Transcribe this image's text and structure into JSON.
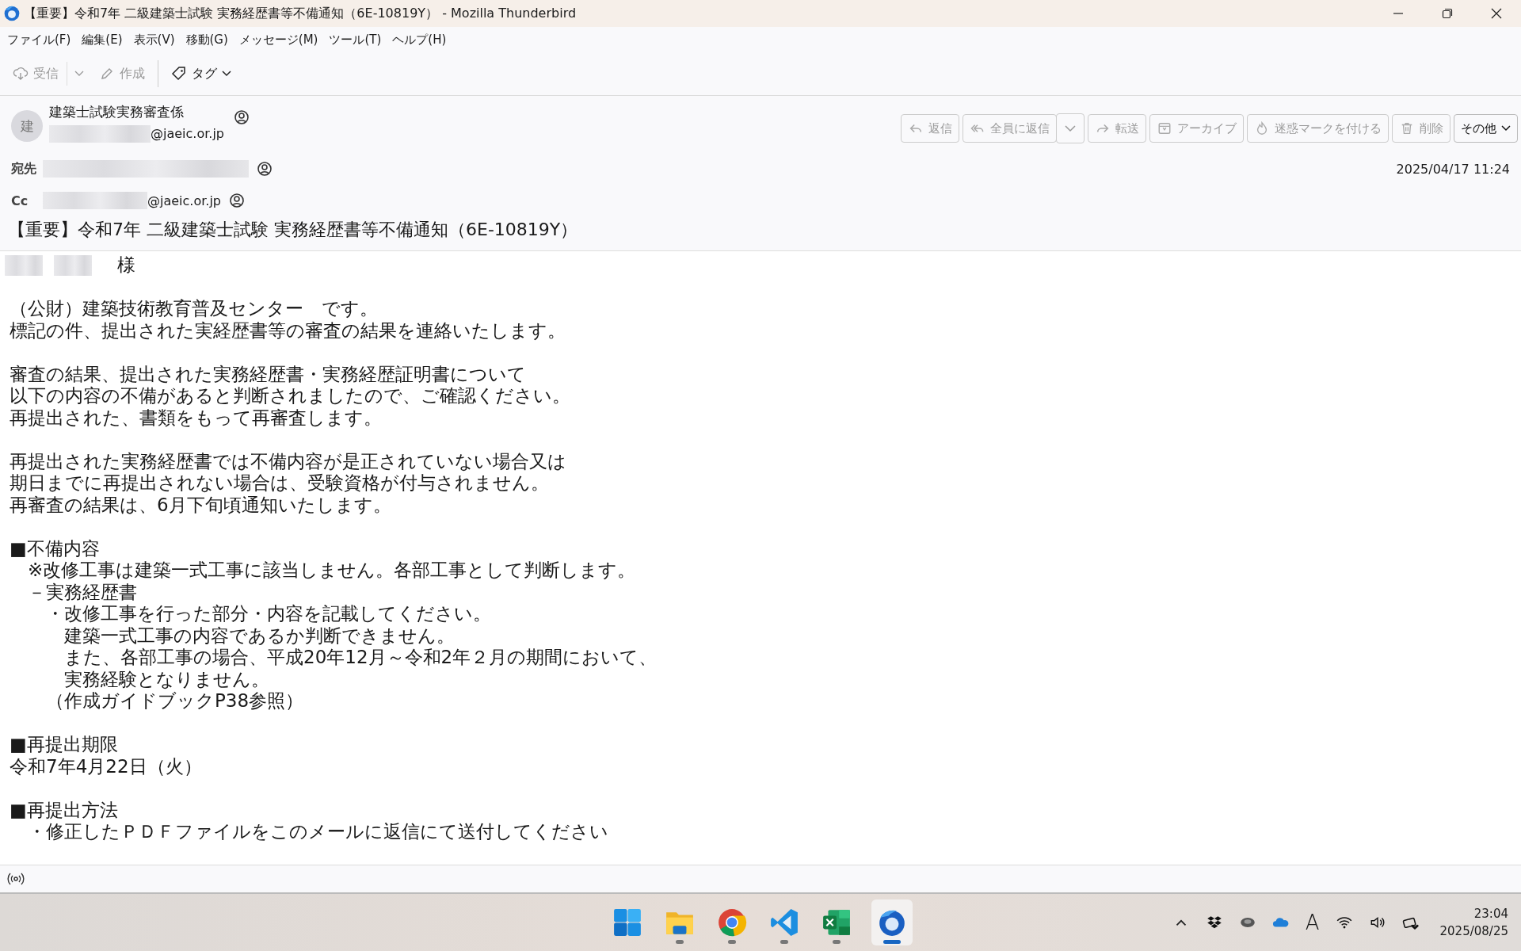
{
  "window": {
    "title": "【重要】令和7年 二級建築士試験 実務経歴書等不備通知（6E-10819Y） - Mozilla Thunderbird"
  },
  "menu": [
    "ファイル(F)",
    "編集(E)",
    "表示(V)",
    "移動(G)",
    "メッセージ(M)",
    "ツール(T)",
    "ヘルプ(H)"
  ],
  "toolbar": [
    {
      "kind": "get",
      "label": "受信",
      "disabled": true
    },
    {
      "kind": "write",
      "label": "作成",
      "disabled": true
    },
    {
      "kind": "tag",
      "label": "タグ",
      "disabled": false
    }
  ],
  "message": {
    "avatar": "建",
    "sender": "建築士試験実務審査係",
    "sender_domain": "@jaeic.or.jp",
    "to_label": "宛先",
    "cc_label": "Cc",
    "cc_domain": "@jaeic.or.jp",
    "date": "2025/04/17 11:24",
    "subject": "【重要】令和7年 二級建築士試験 実務経歴書等不備通知（6E-10819Y）",
    "actions": [
      {
        "kind": "reply",
        "label": "返信",
        "disabled": true
      },
      {
        "kind": "reply-all",
        "label": "全員に返信",
        "disabled": true
      },
      {
        "kind": "forward",
        "label": "転送",
        "disabled": true
      },
      {
        "kind": "archive",
        "label": "アーカイブ",
        "disabled": true
      },
      {
        "kind": "junk",
        "label": "迷惑マークを付ける",
        "disabled": true
      },
      {
        "kind": "delete",
        "label": "削除",
        "disabled": true
      },
      {
        "kind": "more",
        "label": "その他",
        "disabled": false
      }
    ]
  },
  "body": {
    "salutation": "様",
    "paragraphs": [
      [
        "（公財）建築技術教育普及センター　です。",
        "標記の件、提出された実経歴書等の審査の結果を連絡いたします。"
      ],
      [
        "審査の結果、提出された実務経歴書・実務経歴証明書について",
        "以下の内容の不備があると判断されましたので、ご確認ください。",
        "再提出された、書類をもって再審査します。"
      ],
      [
        "再提出された実務経歴書では不備内容が是正されていない場合又は",
        "期日までに再提出されない場合は、受験資格が付与されません。",
        "再審査の結果は、6月下旬頃通知いたします。"
      ],
      [
        "■不備内容",
        "　※改修工事は建築一式工事に該当しません。各部工事として判断します。",
        "　－実務経歴書",
        "　　・改修工事を行った部分・内容を記載してください。",
        "　　　建築一式工事の内容であるか判断できません。",
        "　　　また、各部工事の場合、平成20年12月～令和2年２月の期間において、",
        "　　　実務経験となりません。",
        "　　（作成ガイドブックP38参照）"
      ],
      [
        "■再提出期限",
        "令和7年4月22日（火）"
      ],
      [
        "■再提出方法",
        "　・修正したＰＤＦファイルをこのメールに返信にて送付してください"
      ]
    ]
  },
  "taskbar": {
    "apps": [
      {
        "kind": "start",
        "running": false,
        "selected": false
      },
      {
        "kind": "files",
        "running": true,
        "selected": false
      },
      {
        "kind": "browser",
        "running": true,
        "selected": false
      },
      {
        "kind": "editor",
        "running": true,
        "selected": false
      },
      {
        "kind": "sheet",
        "running": true,
        "selected": false
      },
      {
        "kind": "mail",
        "running": true,
        "selected": true
      }
    ],
    "ime": "A",
    "time": "23:04",
    "date": "2025/08/25"
  }
}
